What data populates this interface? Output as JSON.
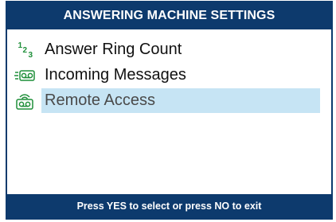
{
  "header": {
    "title": "ANSWERING MACHINE SETTINGS"
  },
  "menu": {
    "items": [
      {
        "label": "Answer Ring Count",
        "icon": "ring-count-icon",
        "selected": false
      },
      {
        "label": "Incoming Messages",
        "icon": "tape-messages-icon",
        "selected": false
      },
      {
        "label": "Remote Access",
        "icon": "remote-access-tape-icon",
        "selected": true
      }
    ],
    "ring_icon_digits": [
      "1",
      "2",
      "3"
    ]
  },
  "footer": {
    "hint": "Press YES to select or press NO to exit"
  },
  "colors": {
    "bar": "#0d3a6d",
    "highlight": "#c6e4f4",
    "icon": "#1f8f3a"
  }
}
